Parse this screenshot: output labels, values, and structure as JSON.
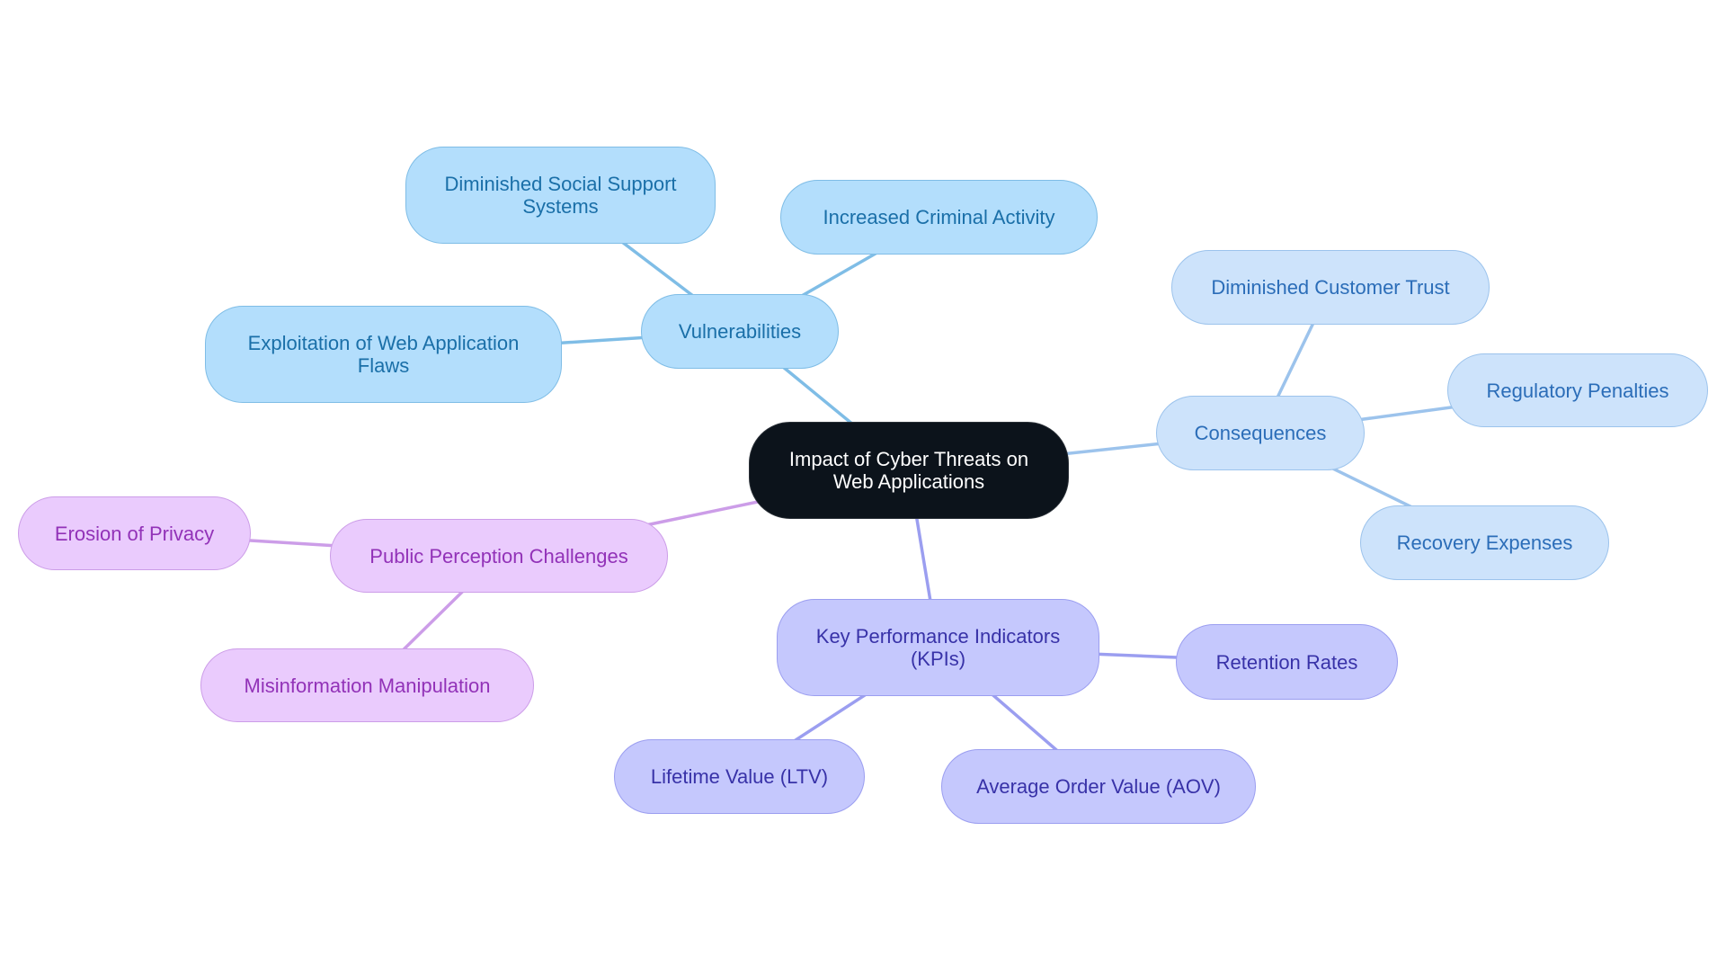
{
  "title": "Impact of Cyber Threats on Web Applications",
  "colors": {
    "root_bg": "#0c131b",
    "vulnerabilities_branch": "#b3defc",
    "consequences_branch": "#cde3fb",
    "kpi_branch": "#c5c8fd",
    "perception_branch": "#eacbfd",
    "edge_vulnerabilities": "#7fbde6",
    "edge_consequences": "#9cc3ec",
    "edge_kpi": "#9b9ef0",
    "edge_perception": "#cc9de8"
  },
  "nodes": {
    "root": {
      "label": "Impact of Cyber Threats on Web Applications"
    },
    "vulnerabilities": {
      "label": "Vulnerabilities"
    },
    "diminished_social": {
      "label": "Diminished Social Support Systems"
    },
    "increased_criminal": {
      "label": "Increased Criminal Activity"
    },
    "exploitation": {
      "label": "Exploitation of Web Application Flaws"
    },
    "consequences": {
      "label": "Consequences"
    },
    "customer_trust": {
      "label": "Diminished Customer Trust"
    },
    "regulatory": {
      "label": "Regulatory Penalties"
    },
    "recovery": {
      "label": "Recovery Expenses"
    },
    "kpi": {
      "label": "Key Performance Indicators (KPIs)"
    },
    "retention": {
      "label": "Retention Rates"
    },
    "ltv": {
      "label": "Lifetime Value (LTV)"
    },
    "aov": {
      "label": "Average Order Value (AOV)"
    },
    "perception": {
      "label": "Public Perception Challenges"
    },
    "privacy": {
      "label": "Erosion of Privacy"
    },
    "misinformation": {
      "label": "Misinformation Manipulation"
    }
  },
  "edges": [
    [
      "root",
      "vulnerabilities",
      "edge_vulnerabilities"
    ],
    [
      "vulnerabilities",
      "diminished_social",
      "edge_vulnerabilities"
    ],
    [
      "vulnerabilities",
      "increased_criminal",
      "edge_vulnerabilities"
    ],
    [
      "vulnerabilities",
      "exploitation",
      "edge_vulnerabilities"
    ],
    [
      "root",
      "consequences",
      "edge_consequences"
    ],
    [
      "consequences",
      "customer_trust",
      "edge_consequences"
    ],
    [
      "consequences",
      "regulatory",
      "edge_consequences"
    ],
    [
      "consequences",
      "recovery",
      "edge_consequences"
    ],
    [
      "root",
      "kpi",
      "edge_kpi"
    ],
    [
      "kpi",
      "retention",
      "edge_kpi"
    ],
    [
      "kpi",
      "ltv",
      "edge_kpi"
    ],
    [
      "kpi",
      "aov",
      "edge_kpi"
    ],
    [
      "root",
      "perception",
      "edge_perception"
    ],
    [
      "perception",
      "privacy",
      "edge_perception"
    ],
    [
      "perception",
      "misinformation",
      "edge_perception"
    ]
  ]
}
